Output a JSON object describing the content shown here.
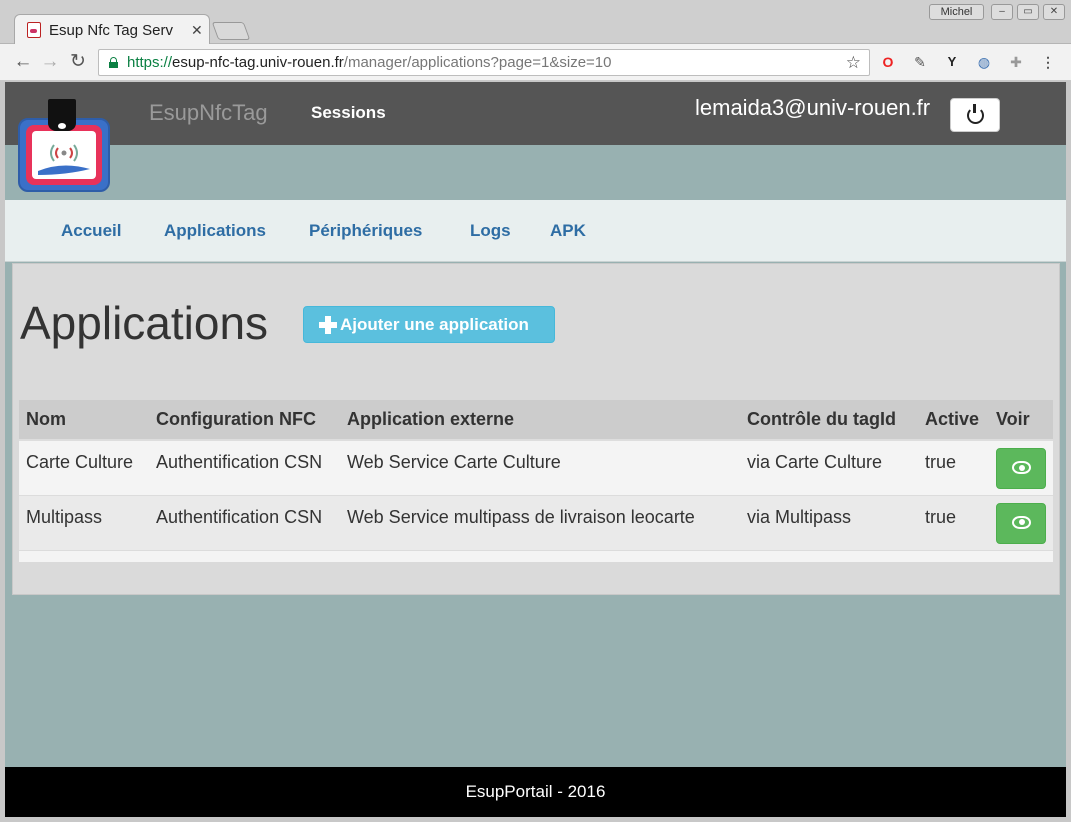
{
  "browser": {
    "tab_title": "Esup Nfc Tag Serv",
    "profile_name": "Michel",
    "url_scheme": "https://",
    "url_host": "esup-nfc-tag.univ-rouen.fr",
    "url_path": "/manager/applications?page=1&size=10"
  },
  "header": {
    "brand": "EsupNfcTag",
    "sessions_link": "Sessions",
    "user_email": "lemaida3@univ-rouen.fr"
  },
  "nav": {
    "items": [
      "Accueil",
      "Applications",
      "Périphériques",
      "Logs",
      "APK"
    ]
  },
  "main": {
    "title": "Applications",
    "add_button_label": "Ajouter une application",
    "table": {
      "columns": [
        "Nom",
        "Configuration NFC",
        "Application externe",
        "Contrôle du tagId",
        "Active",
        "Voir"
      ],
      "rows": [
        [
          "Carte Culture",
          "Authentification CSN",
          "Web Service Carte Culture",
          "via Carte Culture",
          "true"
        ],
        [
          "Multipass",
          "Authentification CSN",
          "Web Service multipass de livraison leocarte",
          "via Multipass",
          "true"
        ]
      ]
    }
  },
  "footer": {
    "text": "EsupPortail - 2016"
  },
  "colors": {
    "header_bg": "#555555",
    "page_bg": "#98b1b1",
    "link": "#2e6da4",
    "info_button": "#5bc0de",
    "success_button": "#5cb85c"
  }
}
